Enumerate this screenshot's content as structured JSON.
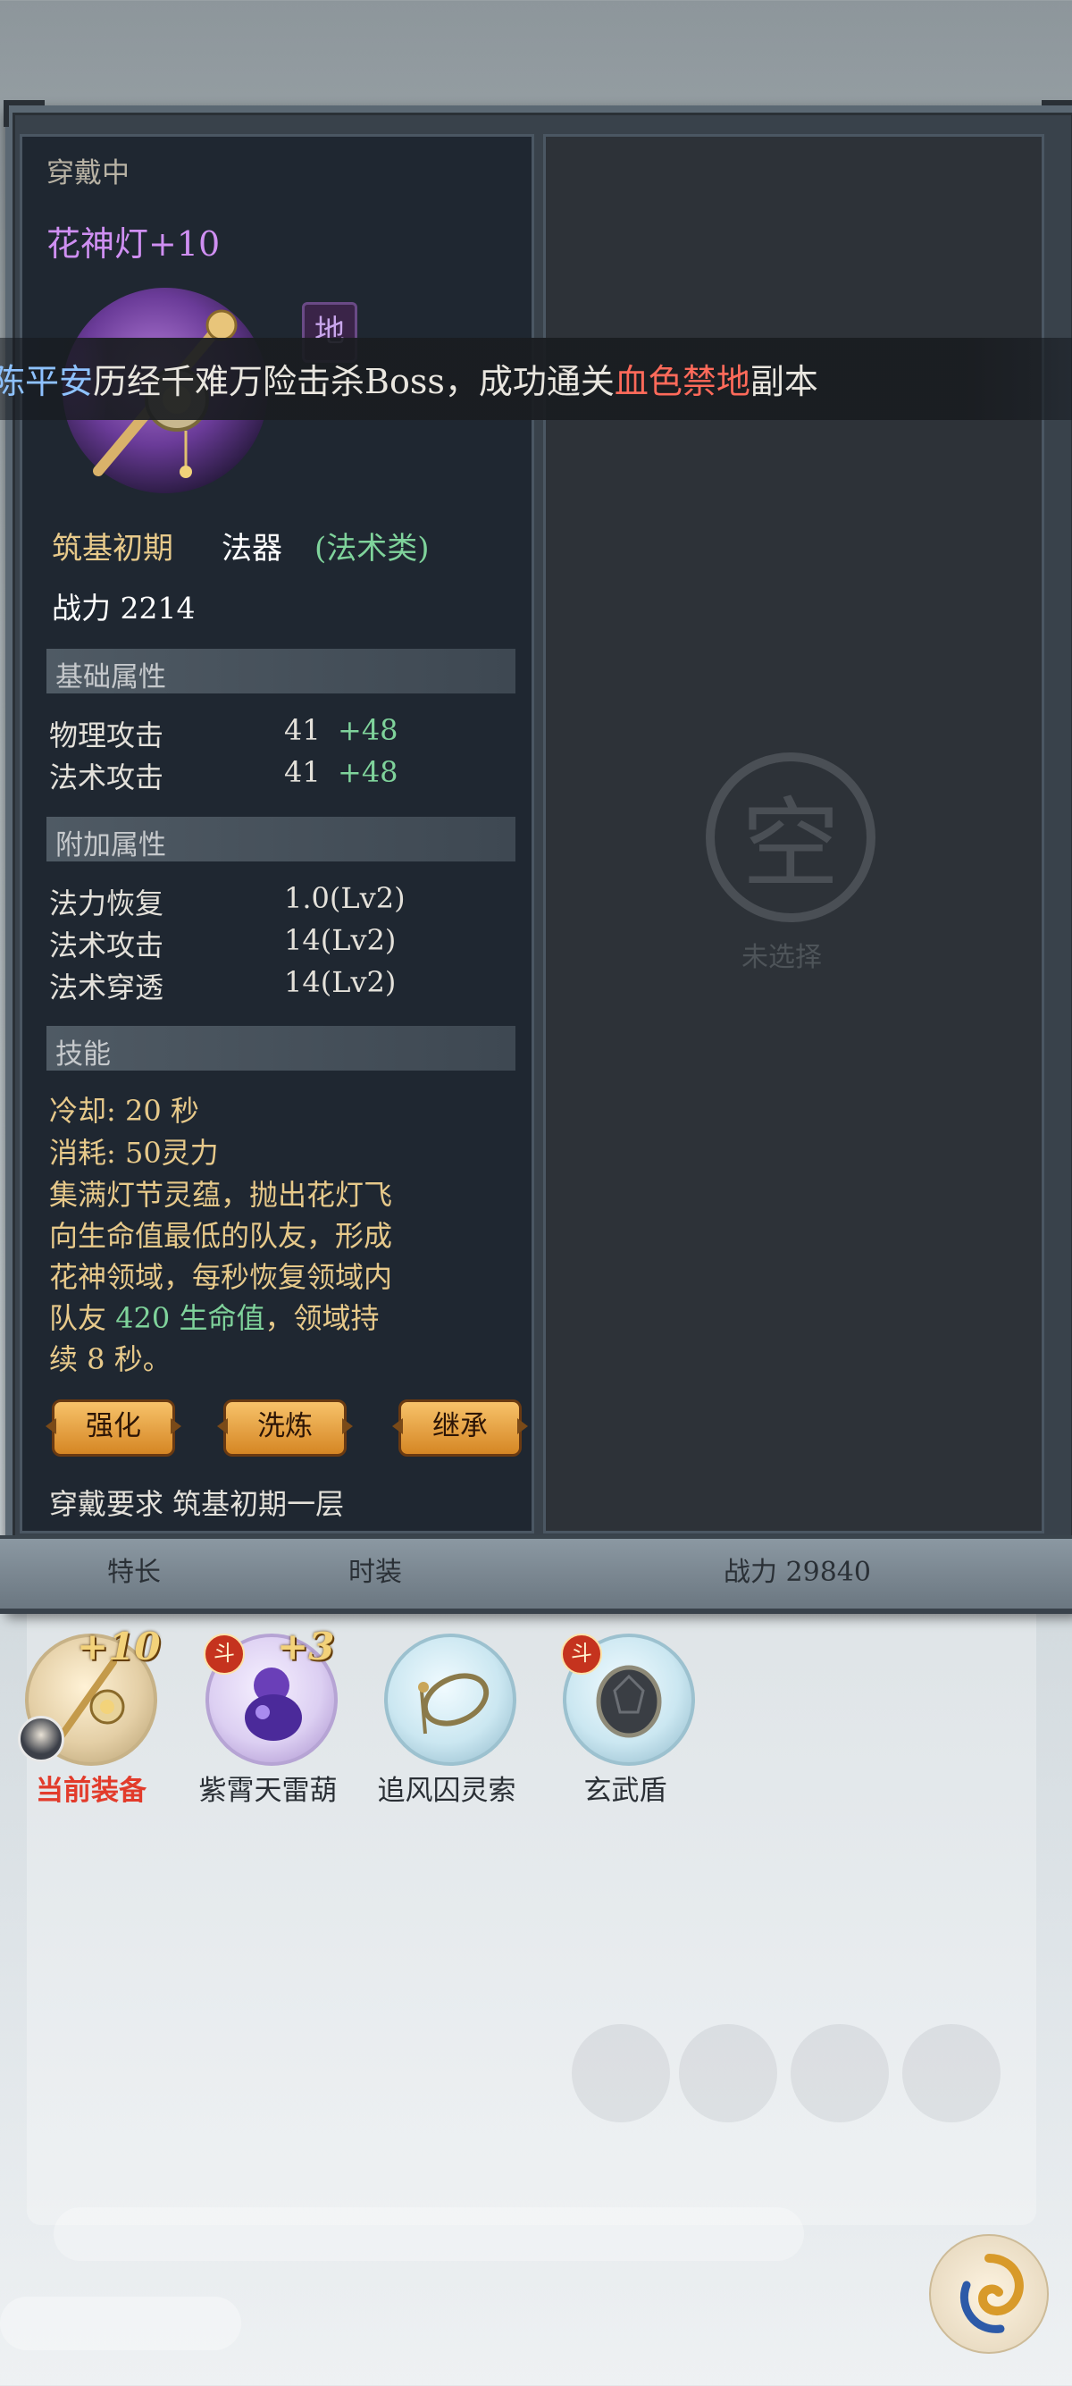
{
  "banner": {
    "name": "陈平安",
    "middle": "历经千难万险击杀Boss，成功通关",
    "place": "血色禁地",
    "suffix": "副本"
  },
  "item": {
    "section_label": "穿戴中",
    "name": "花神灯+10",
    "grade_badge": "地",
    "realm": "筑基初期",
    "kind": "法器",
    "school": "(法术类)",
    "power_label": "战力",
    "power_value": "2214"
  },
  "base_attrs": {
    "title": "基础属性",
    "rows": [
      {
        "label": "物理攻击",
        "value": "41",
        "bonus": "+48"
      },
      {
        "label": "法术攻击",
        "value": "41",
        "bonus": "+48"
      }
    ]
  },
  "extra_attrs": {
    "title": "附加属性",
    "rows": [
      {
        "label": "法力恢复",
        "value": "1.0(Lv2)"
      },
      {
        "label": "法术攻击",
        "value": "14(Lv2)"
      },
      {
        "label": "法术穿透",
        "value": "14(Lv2)"
      }
    ]
  },
  "skill": {
    "title": "技能",
    "cooldown": "冷却:  20 秒",
    "cost": "消耗:  50灵力",
    "desc_line1": "集满灯节灵蕴，抛出花灯飞",
    "desc_line2": "向生命值最低的队友，形成",
    "desc_line3": "花神领域，每秒恢复领域内",
    "desc_line4_a": "队友 ",
    "desc_line4_heal": "420  生命值",
    "desc_line4_b": "，领域持",
    "desc_line5": "续 8 秒。"
  },
  "buttons": {
    "strengthen": "强化",
    "refine": "洗炼",
    "inherit": "继承"
  },
  "requirement": "穿戴要求  筑基初期一层",
  "compare": {
    "seal_glyph": "空",
    "status": "未选择"
  },
  "underbar": {
    "left": "特长",
    "middle": "时装",
    "right": "战力 29840"
  },
  "equipment": [
    {
      "label": "当前装备",
      "level": "+10",
      "badge": ""
    },
    {
      "label": "紫霄天雷葫",
      "level": "+3",
      "badge": "斗"
    },
    {
      "label": "追风囚灵索",
      "level": "",
      "badge": ""
    },
    {
      "label": "玄武盾",
      "level": "",
      "badge": "斗"
    }
  ],
  "colors": {
    "item_name": "#cf8ff2",
    "realm": "#e7c98a",
    "bonus_green": "#7fd39b",
    "current_label": "#e23b2b",
    "banner_name": "#8ec2ff",
    "banner_place": "#ff6a5a"
  }
}
